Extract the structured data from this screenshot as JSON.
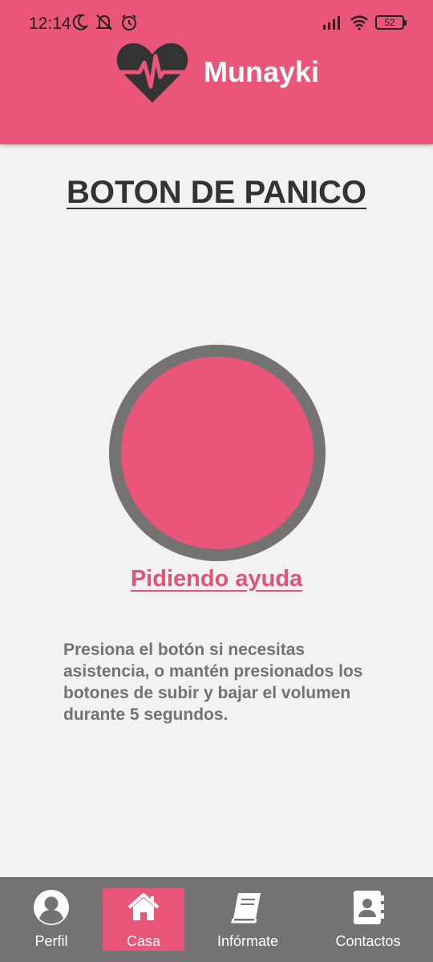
{
  "status_bar": {
    "time": "12:14",
    "battery": "52"
  },
  "header": {
    "app_name": "Munayki",
    "icon": "heartbeat-icon",
    "background": "#ea5679"
  },
  "main": {
    "title": "BOTON DE PANICO",
    "status_link": "Pidiendo ayuda",
    "instructions": "Presiona el botón si necesitas asistencia, o mantén presionados los botones de subir y bajar el volumen durante 5 segundos.",
    "button_colors": {
      "ring": "#757272",
      "fill": "#ea5679"
    }
  },
  "bottom_nav": {
    "items": [
      {
        "label": "Perfil",
        "icon": "user-icon",
        "active": false
      },
      {
        "label": "Casa",
        "icon": "home-icon",
        "active": true
      },
      {
        "label": "Infórmate",
        "icon": "book-icon",
        "active": false
      },
      {
        "label": "Contactos",
        "icon": "contacts-icon",
        "active": false
      }
    ]
  }
}
